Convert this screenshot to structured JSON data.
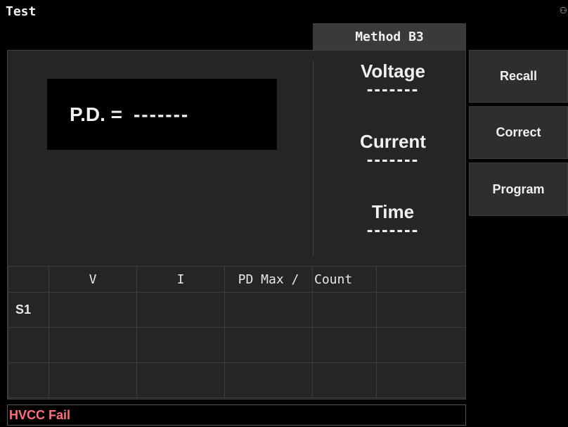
{
  "app": {
    "title": "Test"
  },
  "method_tab": {
    "label": "Method B3"
  },
  "pd_display": {
    "label": "P.D. =",
    "value": "-------"
  },
  "readouts": {
    "voltage": {
      "label": "Voltage",
      "value": "-------"
    },
    "current": {
      "label": "Current",
      "value": "-------"
    },
    "time": {
      "label": "Time",
      "value": "-------"
    }
  },
  "table": {
    "headers": [
      "",
      "V",
      "I",
      "PD Max /",
      "Count",
      ""
    ],
    "rows": [
      [
        "S1",
        "",
        "",
        "",
        "",
        ""
      ],
      [
        "",
        "",
        "",
        "",
        "",
        ""
      ],
      [
        "",
        "",
        "",
        "",
        "",
        ""
      ]
    ]
  },
  "side_buttons": {
    "recall": "Recall",
    "correct": "Correct",
    "program": "Program"
  },
  "status": {
    "message": "HVCC Fail",
    "color": "#ff6f7a"
  },
  "icons": {
    "corner": "usb-icon"
  }
}
